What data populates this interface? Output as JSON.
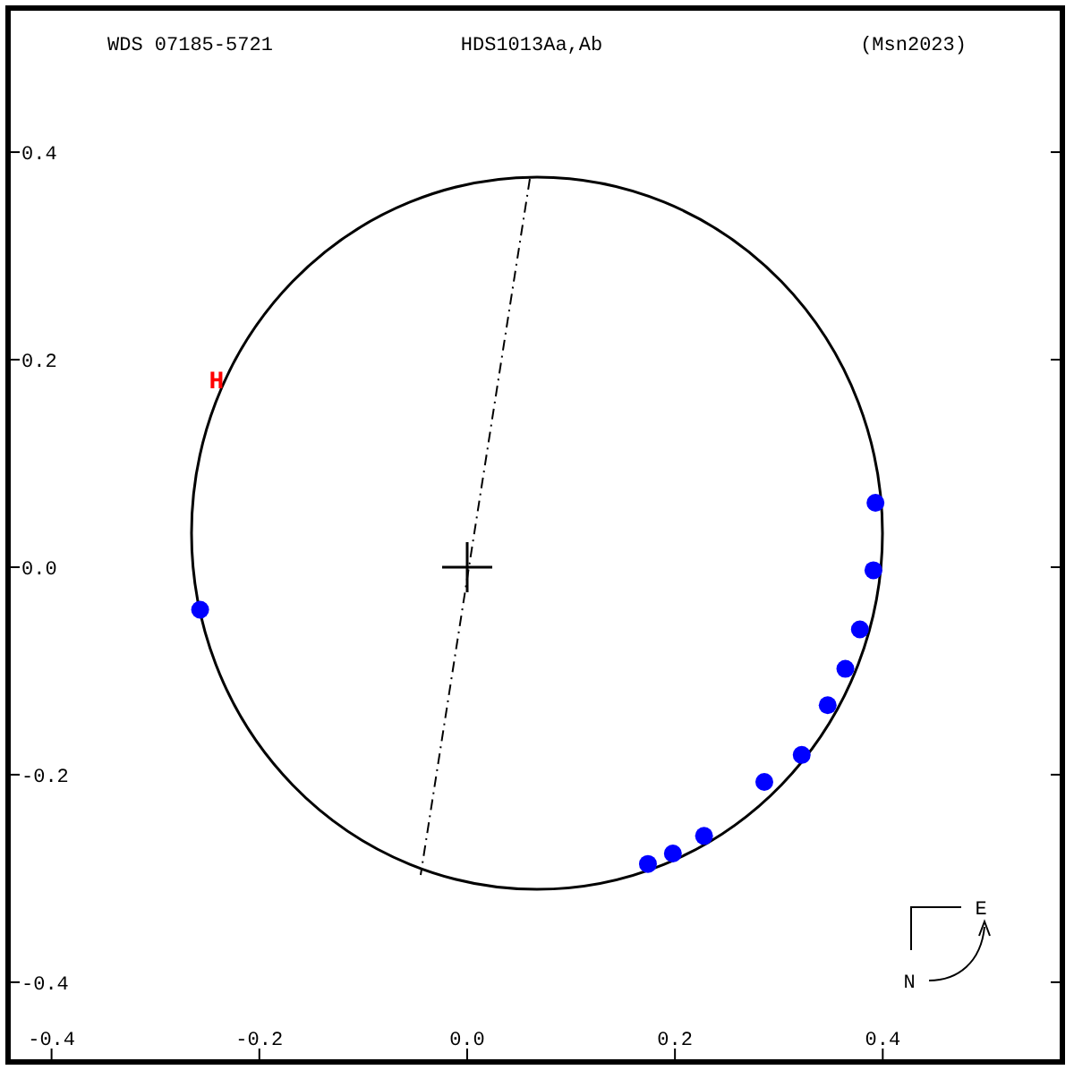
{
  "header": {
    "left": "WDS 07185-5721",
    "center": "HDS1013Aa,Ab",
    "right": "(Msn2023)"
  },
  "chart_data": {
    "type": "scatter",
    "x": [
      0.393,
      0.391,
      0.378,
      0.364,
      0.347,
      0.322,
      0.286,
      0.228,
      0.198,
      0.174,
      -0.257
    ],
    "series": [
      {
        "color": "#0000ff",
        "values": [
          0.062,
          -0.003,
          -0.06,
          -0.098,
          -0.133,
          -0.181,
          -0.207,
          -0.259,
          -0.276,
          -0.286,
          -0.041
        ]
      }
    ],
    "xlim": [
      -0.441,
      0.572
    ],
    "ylim": [
      -0.476,
      0.538
    ],
    "xticks": [
      {
        "value": -0.4,
        "label": "-0.4"
      },
      {
        "value": -0.2,
        "label": "-0.2"
      },
      {
        "value": 0,
        "label": "0.0"
      },
      {
        "value": 0.2,
        "label": "0.2"
      },
      {
        "value": 0.4,
        "label": "0.4"
      }
    ],
    "yticks": [
      {
        "value": 0.4,
        "label": "0.4"
      },
      {
        "value": 0.2,
        "label": "0.2"
      },
      {
        "value": 0,
        "label": "0.0"
      },
      {
        "value": -0.2,
        "label": "-0.2"
      },
      {
        "value": -0.4,
        "label": "-0.4"
      }
    ],
    "annotations": [
      "H"
    ]
  },
  "compass": {
    "east": "E",
    "north": "N"
  }
}
